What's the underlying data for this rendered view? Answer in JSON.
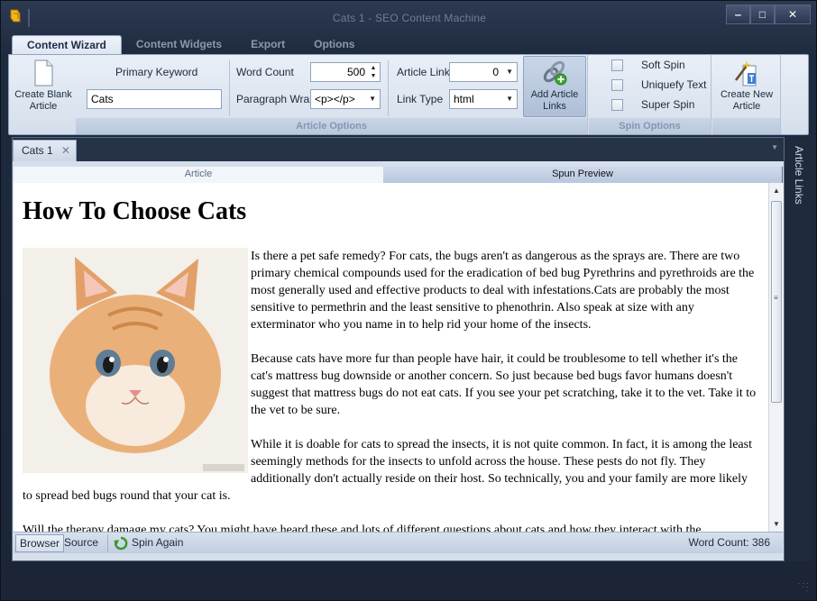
{
  "window": {
    "title": "Cats 1 - SEO Content Machine",
    "controls": {
      "minimize": "‒",
      "maximize": "□",
      "close": "✕"
    }
  },
  "ribbon_tabs": [
    "Content Wizard",
    "Content Widgets",
    "Export",
    "Options"
  ],
  "ribbon": {
    "create_blank_article": "Create Blank Article",
    "primary_keyword": {
      "label": "Primary Keyword",
      "value": "Cats"
    },
    "word_count": {
      "label": "Word Count",
      "value": "500"
    },
    "paragraph_wrap": {
      "label": "Paragraph Wrap",
      "value": "<p></p>"
    },
    "article_links": {
      "label": "Article Links",
      "value": "0"
    },
    "link_type": {
      "label": "Link Type",
      "value": "html"
    },
    "add_article_links": "Add Article Links",
    "article_options_label": "Article Options",
    "soft_spin": "Soft Spin",
    "uniquefy_text": "Uniquefy Text",
    "super_spin": "Super Spin",
    "spin_options_label": "Spin Options",
    "create_new_article": "Create New Article"
  },
  "document": {
    "tab_label": "Cats 1",
    "tab_close": "✕",
    "view_tabs": {
      "article": "Article",
      "spun_preview": "Spun Preview"
    },
    "article_title": "How To Choose Cats",
    "paragraphs": [
      "Is there a pet safe  remedy? For cats, the bugs aren't as dangerous as the sprays are. There are two primary chemical compounds used for the eradication of bed bug Pyrethrins and pyrethroids are the most generally used and effective products to deal with  infestations.Cats are probably the most sensitive to permethrin and the least sensitive to phenothrin. Also speak at size with any exterminator who you name in to help rid your home of the insects.",
      "Because cats have more fur than people have hair, it could be troublesome to tell whether it's the cat's mattress bug downside or another concern. So just because bed bugs favor humans doesn't suggest that mattress bugs do not eat cats. If you see your pet scratching, take it to the vet. Take it to the vet to be sure.",
      "While it is doable for cats to spread the insects, it is not quite common. In fact, it is among the least seemingly methods for the insects to unfold across the house. These pests do not fly. They additionally don't actually reside on their host. So technically, you and your family are more likely to spread bed bugs round that your cat is.",
      "Will the therapy damage my cats? You might have heard these and lots of different questions about cats and how they interact with  the"
    ]
  },
  "statusbar": {
    "browser": "Browser",
    "source": "Source",
    "spin_again": "Spin Again",
    "word_count": "Word Count: 386"
  },
  "side_panel": {
    "label": "Article Links"
  },
  "colors": {
    "accent": "#2c3a52",
    "ribbon": "#dde6f1",
    "selected_tab": "#b8c8e0"
  }
}
